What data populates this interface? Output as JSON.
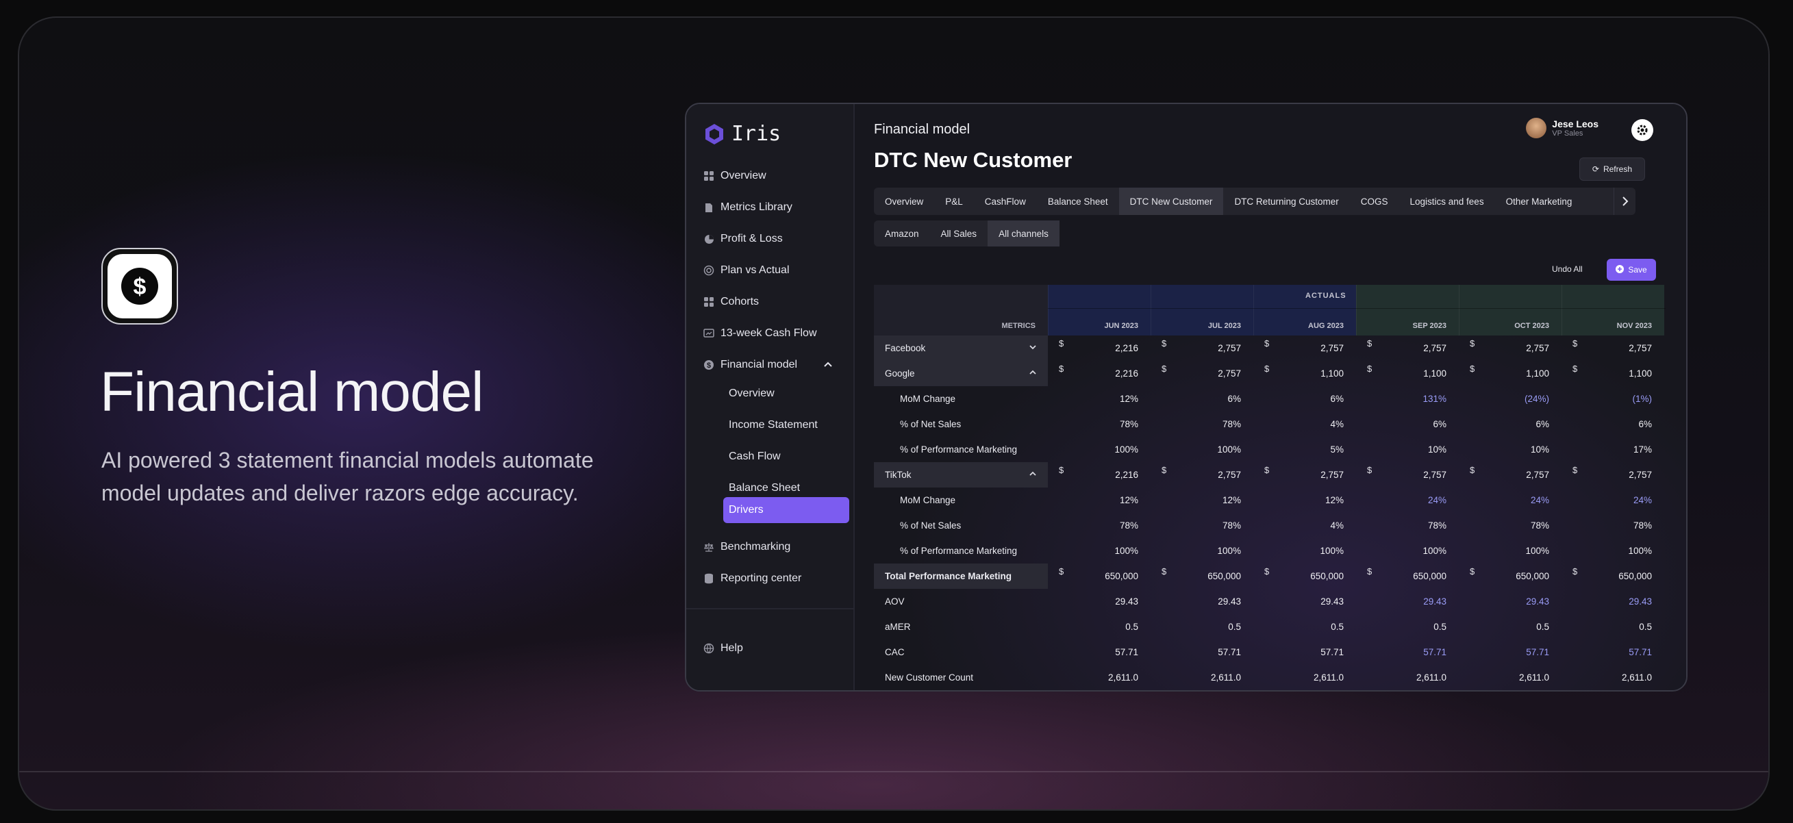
{
  "hero": {
    "title": "Financial model",
    "description": "AI powered 3 statement financial models automate model updates and deliver razors edge accuracy.",
    "icon": "dollar-coin-icon"
  },
  "app": {
    "logo": "Iris",
    "nav": [
      {
        "label": "Overview",
        "icon": "grid-icon"
      },
      {
        "label": "Metrics Library",
        "icon": "document-icon"
      },
      {
        "label": "Profit & Loss",
        "icon": "pie-chart-icon"
      },
      {
        "label": "Plan vs Actual",
        "icon": "target-icon"
      },
      {
        "label": "Cohorts",
        "icon": "grid-icon"
      },
      {
        "label": "13-week Cash Flow",
        "icon": "chart-card-icon"
      },
      {
        "label": "Financial model",
        "icon": "dollar-icon"
      }
    ],
    "financial_sub": [
      "Overview",
      "Income Statement",
      "Cash Flow",
      "Balance Sheet",
      "Drivers"
    ],
    "nav_after": [
      {
        "label": "Benchmarking",
        "icon": "scale-icon"
      },
      {
        "label": "Reporting center",
        "icon": "database-icon"
      }
    ],
    "help": "Help",
    "breadcrumb": "Financial model",
    "page_title": "DTC New Customer",
    "user": {
      "name": "Jese Leos",
      "role": "VP Sales"
    },
    "refresh": "Refresh",
    "tabs": [
      "Overview",
      "P&L",
      "CashFlow",
      "Balance Sheet",
      "DTC New Customer",
      "DTC Returning Customer",
      "COGS",
      "Logistics and fees",
      "Other Marketing"
    ],
    "active_tab": "DTC New Customer",
    "subtabs": [
      "Amazon",
      "All Sales",
      "All channels"
    ],
    "active_subtab": "All channels",
    "undo": "Undo All",
    "save": "Save",
    "colors": {
      "accent": "#7c5cf0",
      "actuals": "#1b2246",
      "forecast": "#22302e",
      "highlight": "#9a9cf6"
    },
    "table": {
      "group_label": "ACTUALS",
      "metrics_label": "METRICS",
      "months": [
        "JUN 2023",
        "JUL 2023",
        "AUG 2023",
        "SEP 2023",
        "OCT 2023",
        "NOV 2023"
      ],
      "actual_months": 3,
      "rows": [
        {
          "label": "Facebook",
          "type": "channel",
          "chevron": "down",
          "dollar": true,
          "values": [
            "2,216",
            "2,757",
            "2,757",
            "2,757",
            "2,757",
            "2,757"
          ]
        },
        {
          "label": "Google",
          "type": "channel",
          "chevron": "up",
          "dollar": true,
          "values": [
            "2,216",
            "2,757",
            "1,100",
            "1,100",
            "1,100",
            "1,100"
          ]
        },
        {
          "label": "MoM Change",
          "type": "sub",
          "values": [
            "12%",
            "6%",
            "6%",
            "131%",
            "(24%)",
            "(1%)"
          ]
        },
        {
          "label": "% of Net Sales",
          "type": "sub",
          "values": [
            "78%",
            "78%",
            "4%",
            "6%",
            "6%",
            "6%"
          ]
        },
        {
          "label": "% of Performance Marketing",
          "type": "sub",
          "values": [
            "100%",
            "100%",
            "5%",
            "10%",
            "10%",
            "17%"
          ]
        },
        {
          "label": "TikTok",
          "type": "channel",
          "chevron": "up",
          "dollar": true,
          "values": [
            "2,216",
            "2,757",
            "2,757",
            "2,757",
            "2,757",
            "2,757"
          ]
        },
        {
          "label": "MoM Change",
          "type": "sub",
          "values": [
            "12%",
            "12%",
            "12%",
            "24%",
            "24%",
            "24%"
          ]
        },
        {
          "label": "% of Net Sales",
          "type": "sub",
          "values": [
            "78%",
            "78%",
            "4%",
            "78%",
            "78%",
            "78%"
          ]
        },
        {
          "label": "% of Performance Marketing",
          "type": "sub",
          "values": [
            "100%",
            "100%",
            "100%",
            "100%",
            "100%",
            "100%"
          ]
        },
        {
          "label": "Total Performance Marketing",
          "type": "total",
          "dollar": true,
          "values": [
            "650,000",
            "650,000",
            "650,000",
            "650,000",
            "650,000",
            "650,000"
          ]
        },
        {
          "label": "AOV",
          "type": "plain",
          "values": [
            "29.43",
            "29.43",
            "29.43",
            "29.43",
            "29.43",
            "29.43"
          ]
        },
        {
          "label": "aMER",
          "type": "plain",
          "values": [
            "0.5",
            "0.5",
            "0.5",
            "0.5",
            "0.5",
            "0.5"
          ]
        },
        {
          "label": "CAC",
          "type": "plain",
          "values": [
            "57.71",
            "57.71",
            "57.71",
            "57.71",
            "57.71",
            "57.71"
          ]
        },
        {
          "label": "New Customer Count",
          "type": "plain",
          "values": [
            "2,611.0",
            "2,611.0",
            "2,611.0",
            "2,611.0",
            "2,611.0",
            "2,611.0"
          ]
        }
      ],
      "highlight_rows": [
        2,
        6,
        10,
        12
      ]
    }
  }
}
